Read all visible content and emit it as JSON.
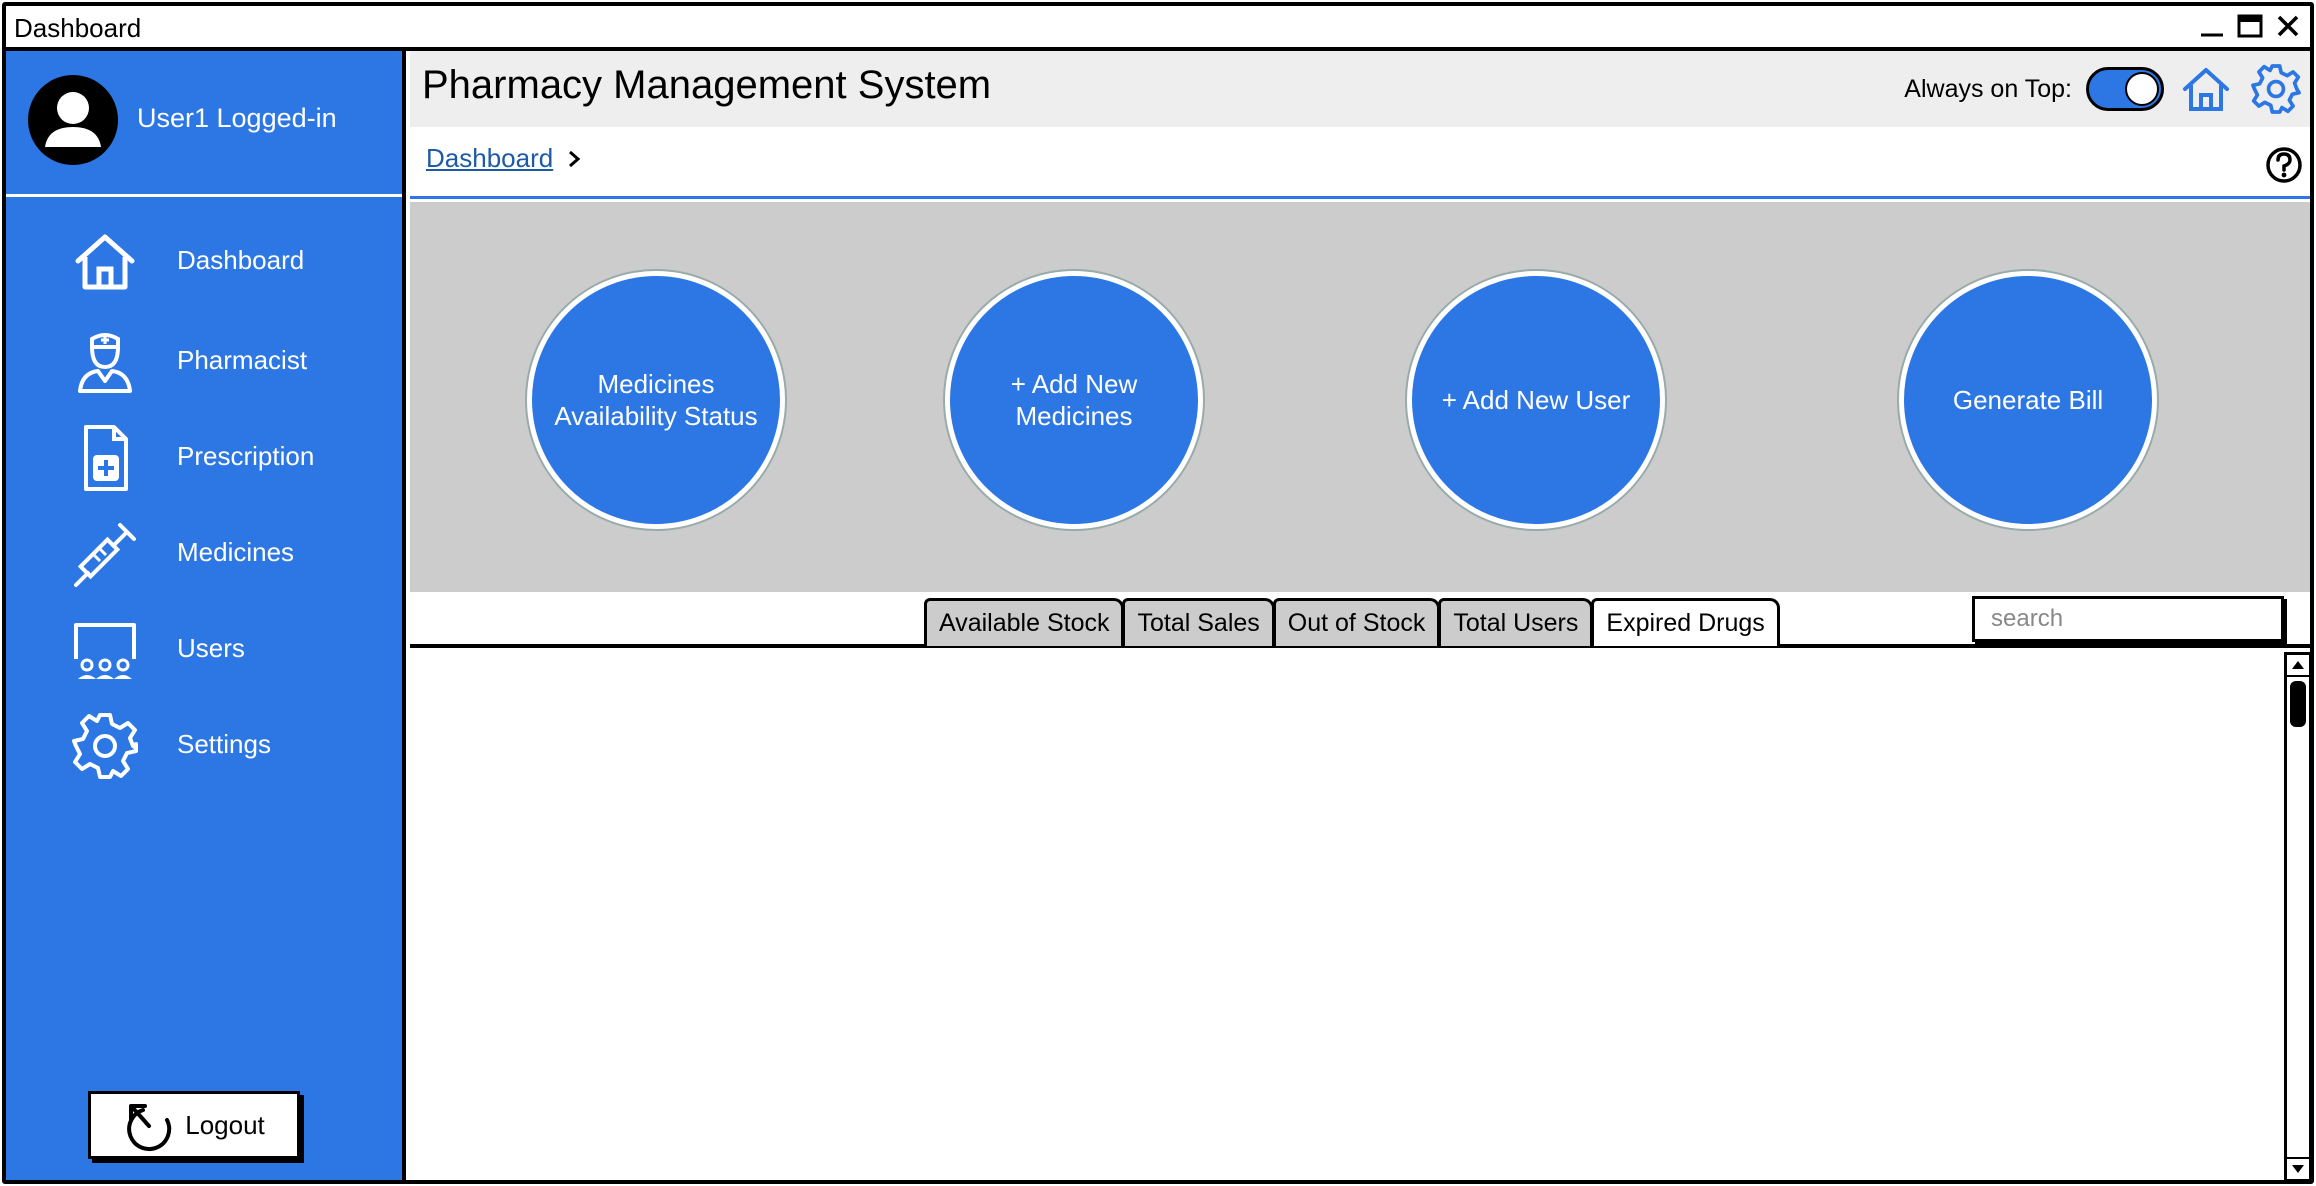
{
  "window": {
    "title": "Dashboard",
    "minimize_icon": "minimize-icon",
    "maximize_icon": "maximize-icon",
    "close_icon": "close-icon"
  },
  "sidebar": {
    "user_label": "User1 Logged-in",
    "items": [
      {
        "label": "Dashboard",
        "icon": "home-icon"
      },
      {
        "label": "Pharmacist",
        "icon": "pharmacist-icon"
      },
      {
        "label": "Prescription",
        "icon": "prescription-icon"
      },
      {
        "label": "Medicines",
        "icon": "syringe-icon"
      },
      {
        "label": "Users",
        "icon": "users-icon"
      },
      {
        "label": "Settings",
        "icon": "gear-icon"
      }
    ],
    "logout_label": "Logout"
  },
  "header": {
    "title": "Pharmacy Management System",
    "always_on_top_label": "Always on Top:",
    "always_on_top": true
  },
  "breadcrumb": {
    "items": [
      "Dashboard"
    ]
  },
  "actions": [
    {
      "label": "Medicines Availability Status"
    },
    {
      "label": "+ Add New Medicines"
    },
    {
      "label": "+ Add New User"
    },
    {
      "label": "Generate Bill"
    }
  ],
  "tabs": [
    {
      "label": "Available Stock"
    },
    {
      "label": "Total Sales"
    },
    {
      "label": "Out of Stock"
    },
    {
      "label": "Total Users"
    },
    {
      "label": "Expired Drugs"
    }
  ],
  "search": {
    "placeholder": "search",
    "value": ""
  },
  "colors": {
    "accent": "#2c77e3",
    "panel_gray": "#cccccc",
    "header_gray": "#eeeeee"
  }
}
